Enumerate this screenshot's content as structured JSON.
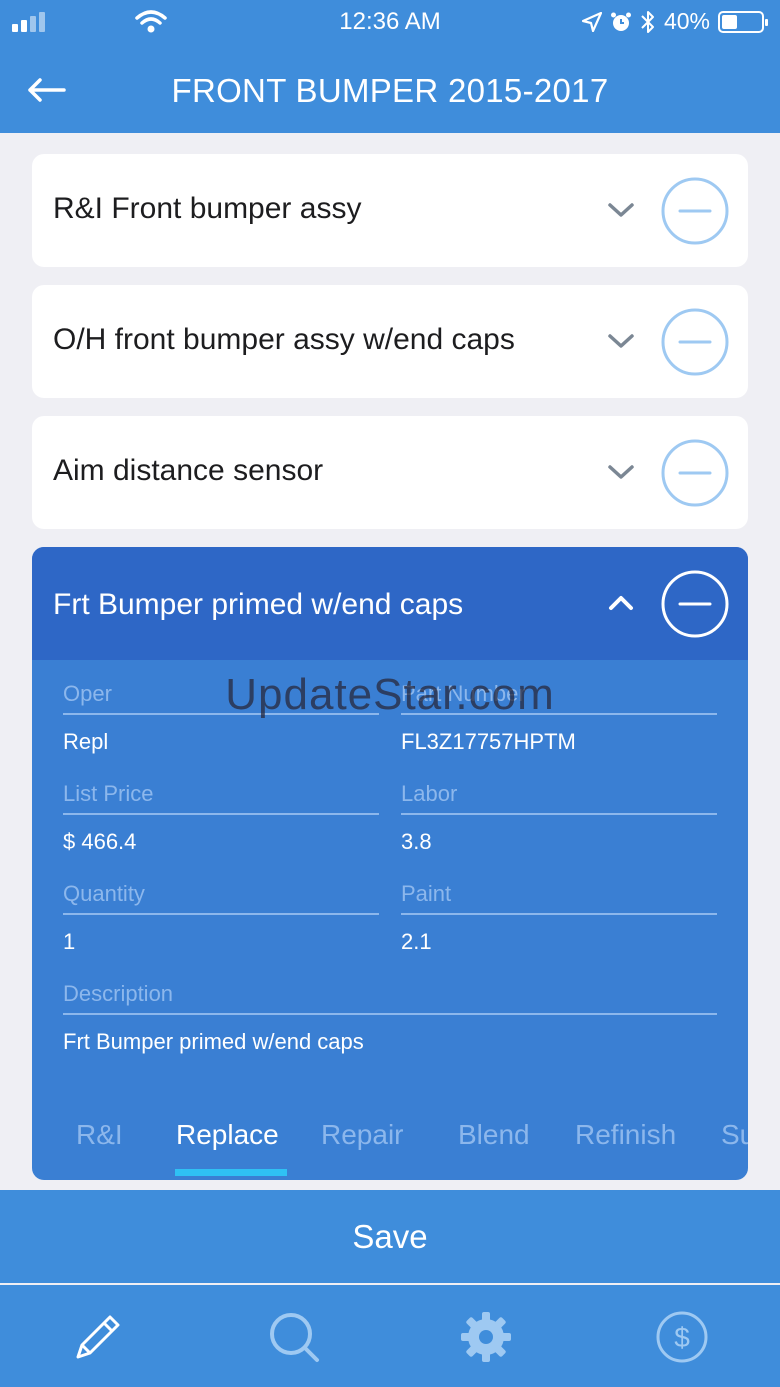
{
  "status": {
    "time": "12:36 AM",
    "battery": "40%",
    "battery_fraction": 0.4
  },
  "nav": {
    "title": "FRONT BUMPER 2015-2017"
  },
  "items": [
    {
      "label": "R&I Front bumper assy"
    },
    {
      "label": "O/H front bumper assy w/end caps"
    },
    {
      "label": "Aim distance sensor"
    }
  ],
  "expanded": {
    "label": "Frt Bumper primed w/end caps",
    "fields": {
      "oper": {
        "label": "Oper",
        "value": "Repl"
      },
      "part_number": {
        "label": "Part Number",
        "value": "FL3Z17757HPTM"
      },
      "list_price": {
        "label": "List Price",
        "value": "$ 466.4"
      },
      "labor": {
        "label": "Labor",
        "value": "3.8"
      },
      "quantity": {
        "label": "Quantity",
        "value": "1"
      },
      "paint": {
        "label": "Paint",
        "value": "2.1"
      },
      "description": {
        "label": "Description",
        "value": "Frt Bumper primed w/end caps"
      }
    },
    "tabs": [
      "R&I",
      "Replace",
      "Repair",
      "Blend",
      "Refinish",
      "Su"
    ],
    "active_tab": "Replace"
  },
  "save_label": "Save",
  "watermark": "UpdateStar.com",
  "icons": {
    "tabbar": [
      "pencil-icon",
      "search-icon",
      "gear-icon",
      "dollar-icon"
    ]
  },
  "colors": {
    "primary": "#3f8ddb",
    "expanded_header": "#2e67c6",
    "expanded_body": "#3a7fd3",
    "tab_indicator": "#2fc1f4"
  }
}
